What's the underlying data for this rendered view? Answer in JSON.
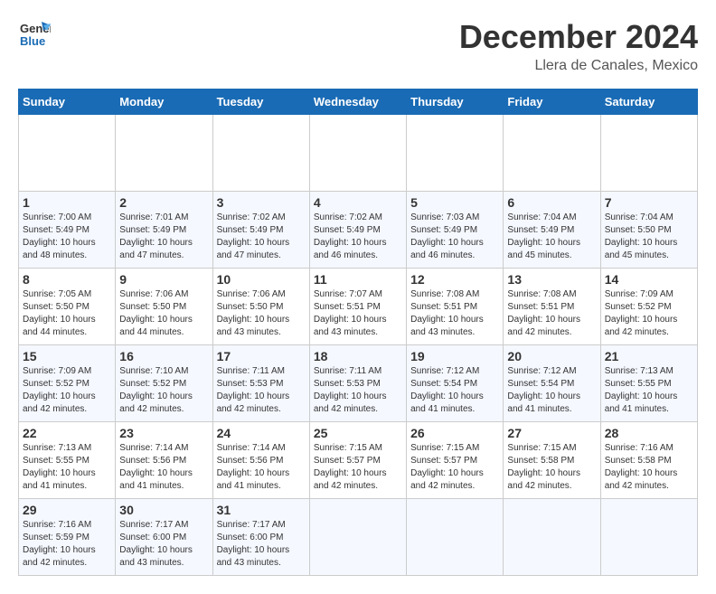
{
  "header": {
    "logo_general": "General",
    "logo_blue": "Blue",
    "month_title": "December 2024",
    "location": "Llera de Canales, Mexico"
  },
  "calendar": {
    "days_of_week": [
      "Sunday",
      "Monday",
      "Tuesday",
      "Wednesday",
      "Thursday",
      "Friday",
      "Saturday"
    ],
    "weeks": [
      [
        {
          "day": "",
          "empty": true
        },
        {
          "day": "",
          "empty": true
        },
        {
          "day": "",
          "empty": true
        },
        {
          "day": "",
          "empty": true
        },
        {
          "day": "",
          "empty": true
        },
        {
          "day": "",
          "empty": true
        },
        {
          "day": "",
          "empty": true
        }
      ],
      [
        {
          "day": "1",
          "sunrise": "7:00 AM",
          "sunset": "5:49 PM",
          "daylight": "10 hours and 48 minutes."
        },
        {
          "day": "2",
          "sunrise": "7:01 AM",
          "sunset": "5:49 PM",
          "daylight": "10 hours and 47 minutes."
        },
        {
          "day": "3",
          "sunrise": "7:02 AM",
          "sunset": "5:49 PM",
          "daylight": "10 hours and 47 minutes."
        },
        {
          "day": "4",
          "sunrise": "7:02 AM",
          "sunset": "5:49 PM",
          "daylight": "10 hours and 46 minutes."
        },
        {
          "day": "5",
          "sunrise": "7:03 AM",
          "sunset": "5:49 PM",
          "daylight": "10 hours and 46 minutes."
        },
        {
          "day": "6",
          "sunrise": "7:04 AM",
          "sunset": "5:49 PM",
          "daylight": "10 hours and 45 minutes."
        },
        {
          "day": "7",
          "sunrise": "7:04 AM",
          "sunset": "5:50 PM",
          "daylight": "10 hours and 45 minutes."
        }
      ],
      [
        {
          "day": "8",
          "sunrise": "7:05 AM",
          "sunset": "5:50 PM",
          "daylight": "10 hours and 44 minutes."
        },
        {
          "day": "9",
          "sunrise": "7:06 AM",
          "sunset": "5:50 PM",
          "daylight": "10 hours and 44 minutes."
        },
        {
          "day": "10",
          "sunrise": "7:06 AM",
          "sunset": "5:50 PM",
          "daylight": "10 hours and 43 minutes."
        },
        {
          "day": "11",
          "sunrise": "7:07 AM",
          "sunset": "5:51 PM",
          "daylight": "10 hours and 43 minutes."
        },
        {
          "day": "12",
          "sunrise": "7:08 AM",
          "sunset": "5:51 PM",
          "daylight": "10 hours and 43 minutes."
        },
        {
          "day": "13",
          "sunrise": "7:08 AM",
          "sunset": "5:51 PM",
          "daylight": "10 hours and 42 minutes."
        },
        {
          "day": "14",
          "sunrise": "7:09 AM",
          "sunset": "5:52 PM",
          "daylight": "10 hours and 42 minutes."
        }
      ],
      [
        {
          "day": "15",
          "sunrise": "7:09 AM",
          "sunset": "5:52 PM",
          "daylight": "10 hours and 42 minutes."
        },
        {
          "day": "16",
          "sunrise": "7:10 AM",
          "sunset": "5:52 PM",
          "daylight": "10 hours and 42 minutes."
        },
        {
          "day": "17",
          "sunrise": "7:11 AM",
          "sunset": "5:53 PM",
          "daylight": "10 hours and 42 minutes."
        },
        {
          "day": "18",
          "sunrise": "7:11 AM",
          "sunset": "5:53 PM",
          "daylight": "10 hours and 42 minutes."
        },
        {
          "day": "19",
          "sunrise": "7:12 AM",
          "sunset": "5:54 PM",
          "daylight": "10 hours and 41 minutes."
        },
        {
          "day": "20",
          "sunrise": "7:12 AM",
          "sunset": "5:54 PM",
          "daylight": "10 hours and 41 minutes."
        },
        {
          "day": "21",
          "sunrise": "7:13 AM",
          "sunset": "5:55 PM",
          "daylight": "10 hours and 41 minutes."
        }
      ],
      [
        {
          "day": "22",
          "sunrise": "7:13 AM",
          "sunset": "5:55 PM",
          "daylight": "10 hours and 41 minutes."
        },
        {
          "day": "23",
          "sunrise": "7:14 AM",
          "sunset": "5:56 PM",
          "daylight": "10 hours and 41 minutes."
        },
        {
          "day": "24",
          "sunrise": "7:14 AM",
          "sunset": "5:56 PM",
          "daylight": "10 hours and 41 minutes."
        },
        {
          "day": "25",
          "sunrise": "7:15 AM",
          "sunset": "5:57 PM",
          "daylight": "10 hours and 42 minutes."
        },
        {
          "day": "26",
          "sunrise": "7:15 AM",
          "sunset": "5:57 PM",
          "daylight": "10 hours and 42 minutes."
        },
        {
          "day": "27",
          "sunrise": "7:15 AM",
          "sunset": "5:58 PM",
          "daylight": "10 hours and 42 minutes."
        },
        {
          "day": "28",
          "sunrise": "7:16 AM",
          "sunset": "5:58 PM",
          "daylight": "10 hours and 42 minutes."
        }
      ],
      [
        {
          "day": "29",
          "sunrise": "7:16 AM",
          "sunset": "5:59 PM",
          "daylight": "10 hours and 42 minutes."
        },
        {
          "day": "30",
          "sunrise": "7:17 AM",
          "sunset": "6:00 PM",
          "daylight": "10 hours and 43 minutes."
        },
        {
          "day": "31",
          "sunrise": "7:17 AM",
          "sunset": "6:00 PM",
          "daylight": "10 hours and 43 minutes."
        },
        {
          "day": "",
          "empty": true
        },
        {
          "day": "",
          "empty": true
        },
        {
          "day": "",
          "empty": true
        },
        {
          "day": "",
          "empty": true
        }
      ]
    ]
  }
}
